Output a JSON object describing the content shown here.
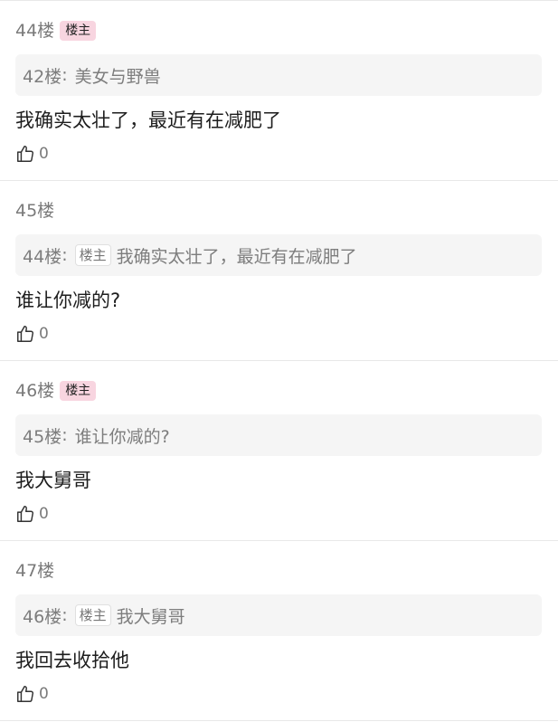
{
  "posts": [
    {
      "floor": "44楼",
      "op_badge": "楼主",
      "quote": {
        "floor": "42楼",
        "sep": ":",
        "badge": "",
        "text": "美女与野兽"
      },
      "content": "我确实太壮了，最近有在减肥了",
      "likes": "0"
    },
    {
      "floor": "45楼",
      "op_badge": "",
      "quote": {
        "floor": "44楼",
        "sep": ":",
        "badge": "楼主",
        "text": "我确实太壮了，最近有在减肥了"
      },
      "content": "谁让你减的?",
      "likes": "0"
    },
    {
      "floor": "46楼",
      "op_badge": "楼主",
      "quote": {
        "floor": "45楼",
        "sep": ":",
        "badge": "",
        "text": "谁让你减的?"
      },
      "content": "我大舅哥",
      "likes": "0"
    },
    {
      "floor": "47楼",
      "op_badge": "",
      "quote": {
        "floor": "46楼",
        "sep": ":",
        "badge": "楼主",
        "text": "我大舅哥"
      },
      "content": "我回去收拾他",
      "likes": "0"
    }
  ],
  "icons": {
    "like": "thumbs-up-icon"
  },
  "colors": {
    "op_badge_bg": "#f8d5e0",
    "quote_bg": "#f5f5f5",
    "divider": "#e8e8e8"
  }
}
